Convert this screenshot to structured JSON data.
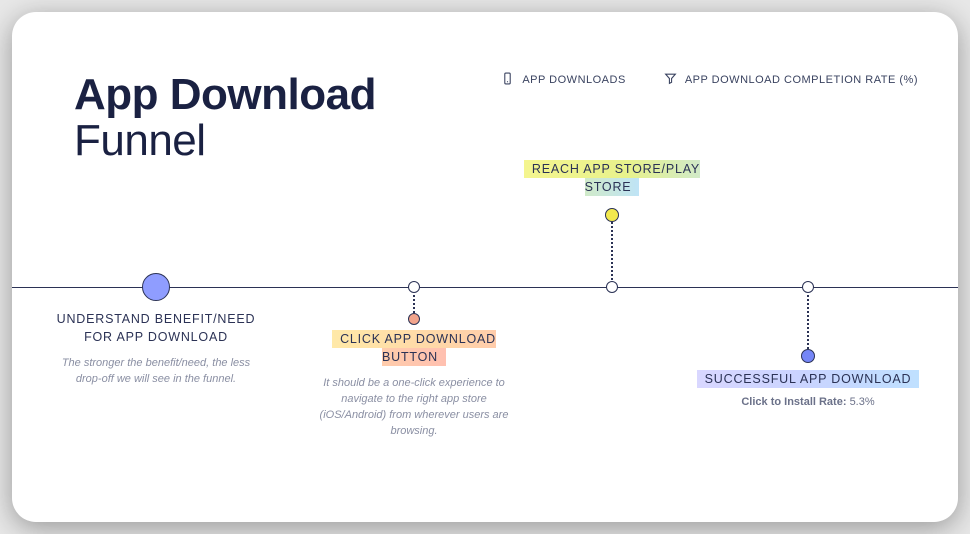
{
  "title": {
    "strong": "App Download",
    "light": "Funnel"
  },
  "metrics": [
    {
      "icon": "phone-icon",
      "label": "APP DOWNLOADS"
    },
    {
      "icon": "funnel-icon",
      "label": "APP DOWNLOAD COMPLETION RATE (%)"
    }
  ],
  "stages": [
    {
      "label": "UNDERSTAND BENEFIT/NEED FOR APP DOWNLOAD",
      "desc": "The stronger the benefit/need, the less drop-off we will see in the funnel."
    },
    {
      "label": "CLICK APP DOWNLOAD BUTTON",
      "desc": "It should be a one-click experience to navigate to the right app store (iOS/Android) from wherever users are browsing."
    },
    {
      "label": "REACH APP STORE/PLAY STORE"
    },
    {
      "label": "SUCCESSFUL APP DOWNLOAD",
      "metric_name": "Click to Install Rate:",
      "metric_value": "5.3%"
    }
  ]
}
